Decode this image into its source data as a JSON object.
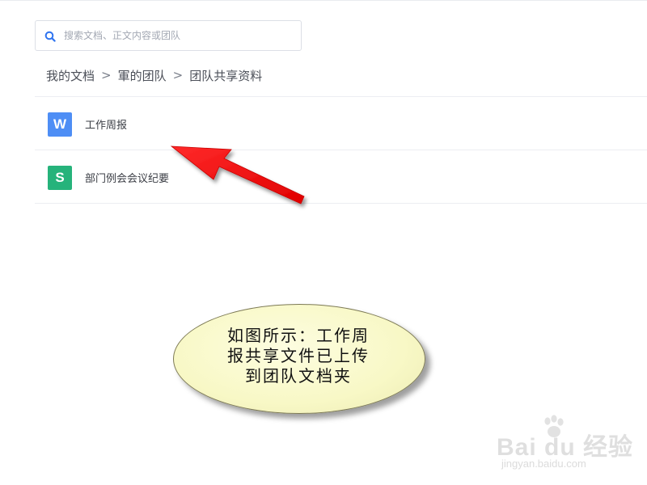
{
  "search": {
    "placeholder": "搜索文档、正文内容或团队"
  },
  "breadcrumb": [
    {
      "label": "我的文档"
    },
    {
      "label": "軍的团队"
    },
    {
      "label": "团队共享资料"
    }
  ],
  "breadcrumb_separator": ">",
  "files": [
    {
      "name": "工作周报",
      "icon_glyph": "W",
      "icon": "wps-writer-doc-icon",
      "icon_color": "#4e8ef5"
    },
    {
      "name": "部门例会会议纪要",
      "icon_glyph": "S",
      "icon": "wps-spreadsheet-icon",
      "icon_color": "#26b37b"
    }
  ],
  "annotation": {
    "lines": [
      "如图所示：工作周",
      "报共享文件已上传",
      "到团队文档夹"
    ],
    "fill_color": "#fafad2",
    "arrow_color": "#ff0000"
  },
  "watermark": {
    "logo_text": "Bai du 经验",
    "url": "jingyan.baidu.com"
  },
  "colors": {
    "accent": "#4285f4",
    "divider": "#eceef2"
  }
}
